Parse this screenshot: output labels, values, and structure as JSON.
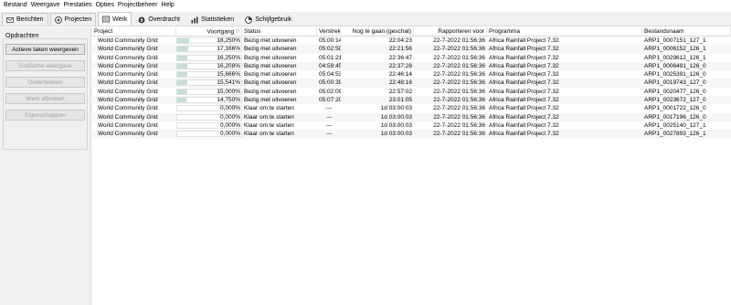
{
  "menu": [
    "Bestand",
    "Weergave",
    "Prestaties",
    "Opties",
    "Projectbeheer",
    "Help"
  ],
  "tabs": [
    {
      "label": "Berichten",
      "icon": "messages-icon",
      "active": false
    },
    {
      "label": "Projecten",
      "icon": "projects-icon",
      "active": false
    },
    {
      "label": "Werk",
      "icon": "tasks-icon",
      "active": true
    },
    {
      "label": "Overdracht",
      "icon": "transfer-icon",
      "active": false
    },
    {
      "label": "Statistieken",
      "icon": "statistics-icon",
      "active": false
    },
    {
      "label": "Schijfgebruik",
      "icon": "disk-usage-icon",
      "active": false
    }
  ],
  "sidebar": {
    "group_label": "Opdrachten",
    "buttons": [
      {
        "label": "Actieve taken weergeven",
        "enabled": true
      },
      {
        "label": "Grafische weergave",
        "enabled": false
      },
      {
        "label": "Onderbreken",
        "enabled": false
      },
      {
        "label": "Werk afbreken",
        "enabled": false
      },
      {
        "label": "Eigenschappen",
        "enabled": false
      }
    ]
  },
  "table": {
    "columns": [
      "Project",
      "Voortgang",
      "Status",
      "Verstrek...",
      "Nog te gaan (geschat)",
      "Rapporteren voor",
      "Programma",
      "Bestandsnaam"
    ],
    "progress_color": "#c8ddd8",
    "rows": [
      {
        "project": "World Community Grid",
        "progress": "18,250%",
        "progress_value": 18.25,
        "status": "Bezig met uitvoeren",
        "elapsed": "05:00:14",
        "remaining": "22:04:23",
        "deadline": "22-7-2022 01:56:36",
        "app": "Africa Rainfall Project 7.32",
        "file": "ARP1_0007151_127_1"
      },
      {
        "project": "World Community Grid",
        "progress": "17,166%",
        "progress_value": 17.166,
        "status": "Bezig met uitvoeren",
        "elapsed": "05:02:50",
        "remaining": "22:21:56",
        "deadline": "22-7-2022 01:56:36",
        "app": "Africa Rainfall Project 7.32",
        "file": "ARP1_0006152_126_1"
      },
      {
        "project": "World Community Grid",
        "progress": "16,250%",
        "progress_value": 16.25,
        "status": "Bezig met uitvoeren",
        "elapsed": "05:01:21",
        "remaining": "22:36:47",
        "deadline": "22-7-2022 01:56:36",
        "app": "Africa Rainfall Project 7.32",
        "file": "ARP1_0029612_126_1"
      },
      {
        "project": "World Community Grid",
        "progress": "16,208%",
        "progress_value": 16.208,
        "status": "Bezig met uitvoeren",
        "elapsed": "04:59:45",
        "remaining": "22:37:28",
        "deadline": "22-7-2022 01:56:36",
        "app": "Africa Rainfall Project 7.32",
        "file": "ARP1_0006491_126_0"
      },
      {
        "project": "World Community Grid",
        "progress": "15,666%",
        "progress_value": 15.666,
        "status": "Bezig met uitvoeren",
        "elapsed": "05:04:53",
        "remaining": "22:46:14",
        "deadline": "22-7-2022 01:56:36",
        "app": "Africa Rainfall Project 7.32",
        "file": "ARP1_0025391_126_0"
      },
      {
        "project": "World Community Grid",
        "progress": "15,541%",
        "progress_value": 15.541,
        "status": "Bezig met uitvoeren",
        "elapsed": "05:00:39",
        "remaining": "22:48:16",
        "deadline": "22-7-2022 01:56:36",
        "app": "Africa Rainfall Project 7.32",
        "file": "ARP1_0019743_127_0"
      },
      {
        "project": "World Community Grid",
        "progress": "15,000%",
        "progress_value": 15.0,
        "status": "Bezig met uitvoeren",
        "elapsed": "05:02:09",
        "remaining": "22:57:02",
        "deadline": "22-7-2022 01:56:36",
        "app": "Africa Rainfall Project 7.32",
        "file": "ARP1_0020477_126_0"
      },
      {
        "project": "World Community Grid",
        "progress": "14,750%",
        "progress_value": 14.75,
        "status": "Bezig met uitvoeren",
        "elapsed": "05:07:20",
        "remaining": "23:01:05",
        "deadline": "22-7-2022 01:56:36",
        "app": "Africa Rainfall Project 7.32",
        "file": "ARP1_0023672_127_0"
      },
      {
        "project": "World Community Grid",
        "progress": "0,000%",
        "progress_value": 0,
        "status": "Klaar om te starten",
        "elapsed": "---",
        "remaining": "1d 03:00:03",
        "deadline": "22-7-2022 01:56:36",
        "app": "Africa Rainfall Project 7.32",
        "file": "ARP1_0001722_126_0"
      },
      {
        "project": "World Community Grid",
        "progress": "0,000%",
        "progress_value": 0,
        "status": "Klaar om te starten",
        "elapsed": "---",
        "remaining": "1d 03:00:03",
        "deadline": "22-7-2022 01:56:36",
        "app": "Africa Rainfall Project 7.32",
        "file": "ARP1_0017196_126_0"
      },
      {
        "project": "World Community Grid",
        "progress": "0,000%",
        "progress_value": 0,
        "status": "Klaar om te starten",
        "elapsed": "---",
        "remaining": "1d 03:00:03",
        "deadline": "22-7-2022 01:56:36",
        "app": "Africa Rainfall Project 7.32",
        "file": "ARP1_0025140_127_1"
      },
      {
        "project": "World Community Grid",
        "progress": "0,000%",
        "progress_value": 0,
        "status": "Klaar om te starten",
        "elapsed": "---",
        "remaining": "1d 03:00:03",
        "deadline": "22-7-2022 01:56:36",
        "app": "Africa Rainfall Project 7.32",
        "file": "ARP1_0027893_126_1"
      }
    ]
  }
}
